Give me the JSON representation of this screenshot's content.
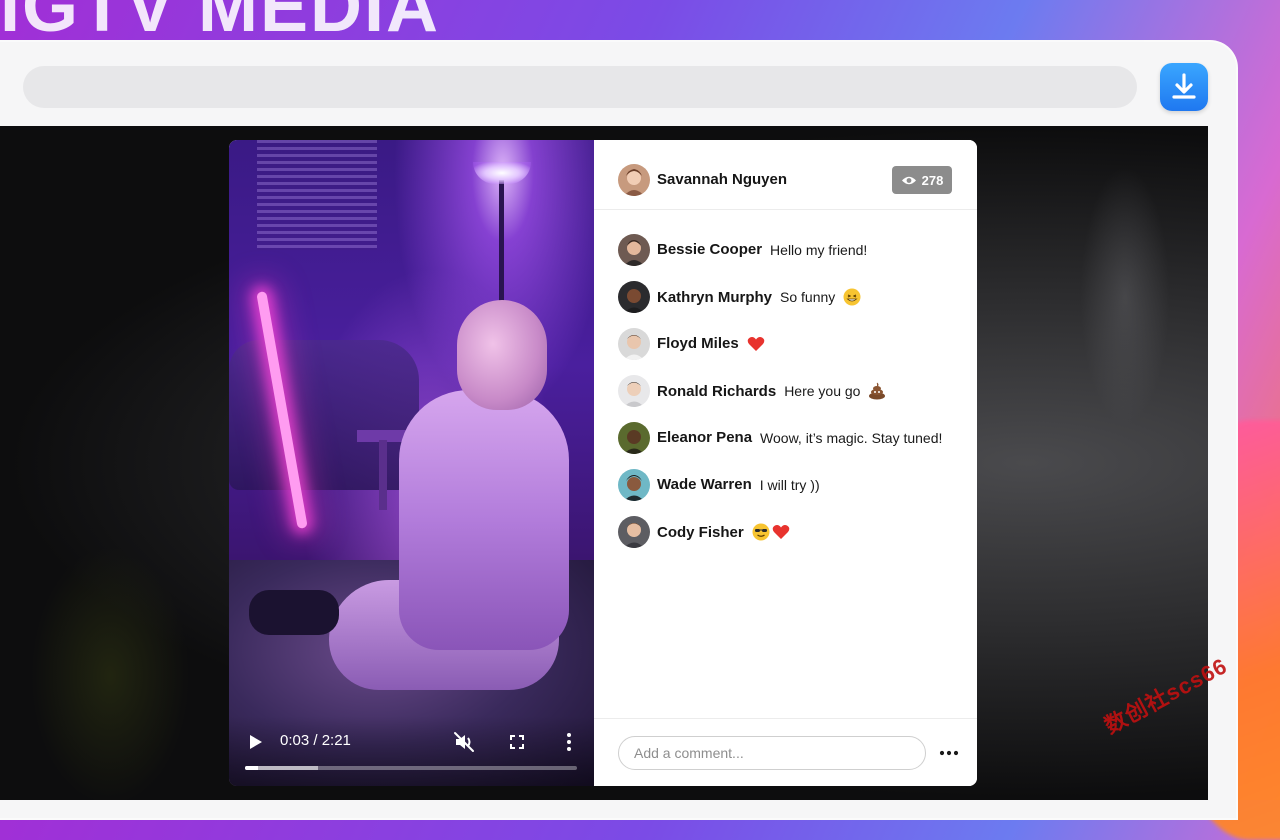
{
  "banner": {
    "title": "IGTV MEDIA"
  },
  "video": {
    "time_display": "0:03 / 2:21",
    "progress_fraction": 0.04,
    "buffered_fraction": 0.22
  },
  "post": {
    "author": "Savannah Nguyen",
    "views": "278"
  },
  "comments": [
    {
      "user": "Bessie Cooper",
      "text": "Hello my friend!",
      "emoji": []
    },
    {
      "user": "Kathryn Murphy",
      "text": "So funny",
      "emoji": [
        "grinning-face"
      ]
    },
    {
      "user": "Floyd Miles",
      "text": "",
      "emoji": [
        "red-heart"
      ]
    },
    {
      "user": "Ronald Richards",
      "text": "Here you go",
      "emoji": [
        "pile-of-poo"
      ]
    },
    {
      "user": "Eleanor Pena",
      "text": "Woow, it’s magic. Stay tuned!",
      "emoji": []
    },
    {
      "user": "Wade Warren",
      "text": "I will try ))",
      "emoji": []
    },
    {
      "user": "Cody Fisher",
      "text": "",
      "emoji": [
        "sunglasses-face",
        "red-heart"
      ]
    }
  ],
  "composer": {
    "placeholder": "Add a comment..."
  },
  "watermark": {
    "text": "数创社scs66"
  },
  "colors": {
    "accent_blue": "#1f78f0",
    "badge_gray": "#8c8c8c",
    "heart_red": "#e8332e"
  }
}
